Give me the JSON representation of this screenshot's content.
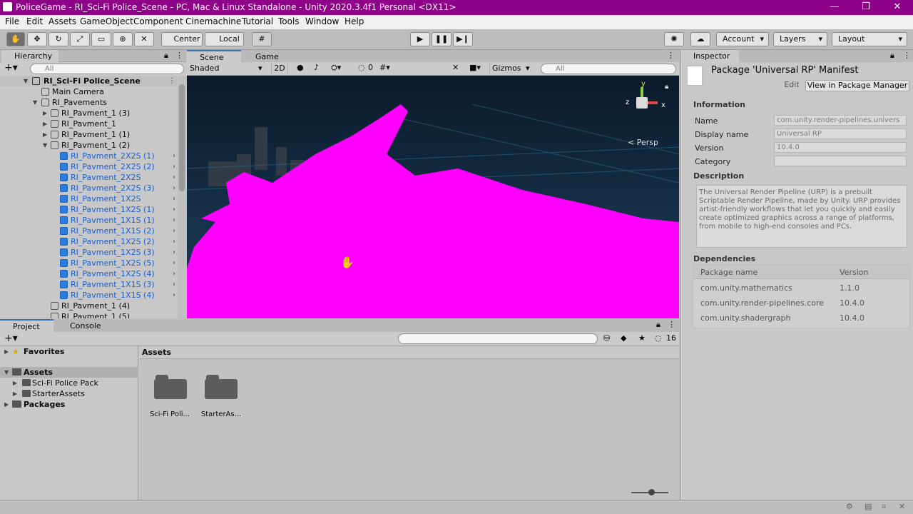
{
  "window": {
    "title": "PoliceGame - RI_Sci-Fi Police_Scene - PC, Mac & Linux Standalone - Unity 2020.3.4f1 Personal <DX11>",
    "accent": "#8f0089"
  },
  "menu": [
    "File",
    "Edit",
    "Assets",
    "GameObject",
    "Component",
    "Cinemachine",
    "Tutorial",
    "Tools",
    "Window",
    "Help"
  ],
  "toolbar": {
    "center": "Center",
    "local": "Local",
    "account": "Account",
    "layers": "Layers",
    "layout": "Layout"
  },
  "hierarchy": {
    "tab": "Hierarchy",
    "search": "All",
    "rows": [
      {
        "label": "RI_Sci-Fi Police_Scene"
      },
      {
        "label": "Main Camera"
      },
      {
        "label": "RI_Pavements"
      },
      {
        "label": "RI_Pavment_1 (3)"
      },
      {
        "label": "RI_Pavment_1"
      },
      {
        "label": "RI_Pavment_1 (1)"
      },
      {
        "label": "RI_Pavment_1 (2)"
      },
      {
        "label": "RI_Pavment_2X2S (1)"
      },
      {
        "label": "RI_Pavment_2X2S (2)"
      },
      {
        "label": "RI_Pavment_2X2S"
      },
      {
        "label": "RI_Pavment_2X2S (3)"
      },
      {
        "label": "RI_Pavment_1X2S"
      },
      {
        "label": "RI_Pavment_1X2S (1)"
      },
      {
        "label": "RI_Pavment_1X1S (1)"
      },
      {
        "label": "RI_Pavment_1X1S (2)"
      },
      {
        "label": "RI_Pavment_1X2S (2)"
      },
      {
        "label": "RI_Pavment_1X2S (3)"
      },
      {
        "label": "RI_Pavment_1X2S (5)"
      },
      {
        "label": "RI_Pavment_1X2S (4)"
      },
      {
        "label": "RI_Pavment_1X1S (3)"
      },
      {
        "label": "RI_Pavment_1X1S (4)"
      },
      {
        "label": "RI_Pavment_1 (4)"
      },
      {
        "label": "RI_Pavment_1 (5)"
      }
    ]
  },
  "scene": {
    "tab_scene": "Scene",
    "tab_game": "Game",
    "shading": "Shaded",
    "mode2d": "2D",
    "fx_count": "0",
    "gizmos": "Gizmos",
    "search": "All",
    "persp": "Persp",
    "axis_y": "y",
    "axis_x": "x",
    "axis_z": "z"
  },
  "project": {
    "tab_project": "Project",
    "tab_console": "Console",
    "count": "16",
    "favorites": "Favorites",
    "assets": "Assets",
    "assets_children": [
      "Sci-Fi Police Pack",
      "StarterAssets"
    ],
    "packages": "Packages",
    "content_title": "Assets",
    "folders": [
      "Sci-Fi Poli...",
      "StarterAs..."
    ]
  },
  "inspector": {
    "tab": "Inspector",
    "heading": "Package 'Universal RP' Manifest",
    "edit": "Edit",
    "view_pm": "View in Package Manager",
    "information": "Information",
    "fields": [
      {
        "k": "Name",
        "v": "com.unity.render-pipelines.univers"
      },
      {
        "k": "Display name",
        "v": "Universal RP"
      },
      {
        "k": "Version",
        "v": "10.4.0"
      },
      {
        "k": "Category",
        "v": ""
      }
    ],
    "description_title": "Description",
    "description": "The Universal Render Pipeline (URP) is a prebuilt Scriptable Render Pipeline, made by Unity. URP provides artist-friendly workflows that let you quickly and easily create optimized graphics across a range of platforms, from mobile to high-end consoles and PCs.",
    "dependencies_title": "Dependencies",
    "dep_col_name": "Package name",
    "dep_col_version": "Version",
    "dependencies": [
      {
        "name": "com.unity.mathematics",
        "version": "1.1.0"
      },
      {
        "name": "com.unity.render-pipelines.core",
        "version": "10.4.0"
      },
      {
        "name": "com.unity.shadergraph",
        "version": "10.4.0"
      }
    ]
  }
}
